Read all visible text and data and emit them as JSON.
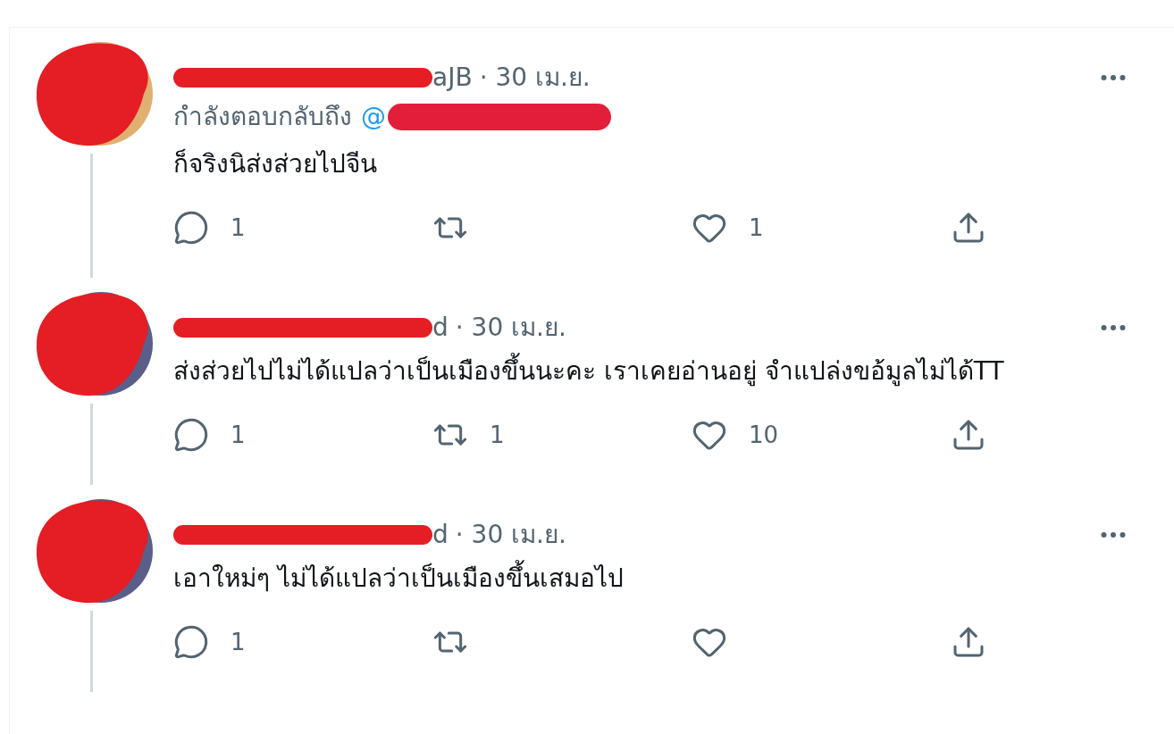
{
  "tweets": [
    {
      "handle_fragment": "aJB",
      "date": "· 30 เม.ย.",
      "replying_to": {
        "label": "กำลังตอบกลับถึง",
        "mention": "@"
      },
      "text": "ก็จริงนิส่งส่วยไปจีน",
      "actions": [
        {
          "kind": "reply",
          "count": "1"
        },
        {
          "kind": "retweet"
        },
        {
          "kind": "like",
          "count": "1"
        },
        {
          "kind": "share"
        }
      ]
    },
    {
      "handle_fragment": "d",
      "date": "· 30 เม.ย.",
      "text": "ส่งส่วยไปไม่ได้แปลว่าเป็นเมืองขึ้นนะคะ เราเคยอ่านอยู่ จำแปล่งขอ้มูลไม่ได้TT",
      "actions": [
        {
          "kind": "reply",
          "count": "1"
        },
        {
          "kind": "retweet",
          "count": "1"
        },
        {
          "kind": "like",
          "count": "10"
        },
        {
          "kind": "share"
        }
      ]
    },
    {
      "handle_fragment": "d",
      "date": "· 30 เม.ย.",
      "text": "เอาใหม่ๆ ไม่ได้แปลว่าเป็นเมืองขึ้นเสมอไป",
      "actions": [
        {
          "kind": "reply",
          "count": "1"
        },
        {
          "kind": "retweet"
        },
        {
          "kind": "like"
        },
        {
          "kind": "share"
        }
      ]
    }
  ]
}
